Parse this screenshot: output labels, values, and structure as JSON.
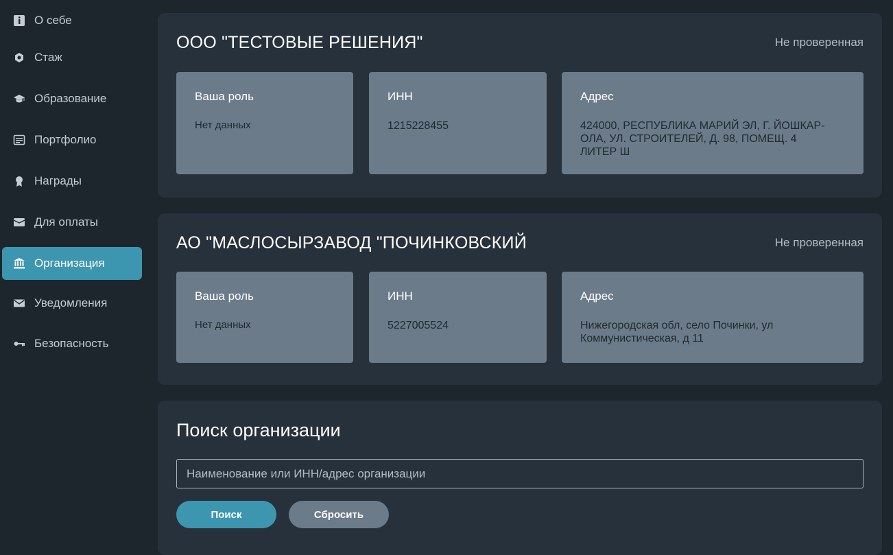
{
  "sidebar": {
    "items": [
      {
        "label": "О себе",
        "icon": "info-icon"
      },
      {
        "label": "Стаж",
        "icon": "hexagon-icon"
      },
      {
        "label": "Образование",
        "icon": "graduation-cap-icon"
      },
      {
        "label": "Портфолио",
        "icon": "document-list-icon"
      },
      {
        "label": "Награды",
        "icon": "award-icon"
      },
      {
        "label": "Для оплаты",
        "icon": "wallet-icon"
      },
      {
        "label": "Организация",
        "icon": "bank-icon",
        "active": true
      },
      {
        "label": "Уведомления",
        "icon": "envelope-icon"
      },
      {
        "label": "Безопасность",
        "icon": "key-icon"
      }
    ]
  },
  "organizations": [
    {
      "name": "ООО \"ТЕСТОВЫЕ РЕШЕНИЯ\"",
      "status": "Не проверенная",
      "role_title": "Ваша роль",
      "role_value": "Нет данных",
      "inn_title": "ИНН",
      "inn_value": "1215228455",
      "address_title": "Адрес",
      "address_value": "424000, РЕСПУБЛИКА МАРИЙ ЭЛ, Г. ЙОШКАР-ОЛА, УЛ. СТРОИТЕЛЕЙ, Д. 98, ПОМЕЩ. 4 ЛИТЕР Ш"
    },
    {
      "name": "АО \"МАСЛОСЫРЗАВОД \"ПОЧИНКОВСКИЙ",
      "status": "Не проверенная",
      "role_title": "Ваша роль",
      "role_value": "Нет данных",
      "inn_title": "ИНН",
      "inn_value": "5227005524",
      "address_title": "Адрес",
      "address_value": "Нижегородская обл, село Починки, ул Коммунистическая, д 11"
    }
  ],
  "search": {
    "title": "Поиск организации",
    "placeholder": "Наименование или ИНН/адрес организации",
    "value": "",
    "search_button": "Поиск",
    "reset_button": "Сбросить"
  },
  "colors": {
    "accent": "#3d96b0",
    "background": "#1d252d",
    "card": "#27313b",
    "info_box": "#6b7b89"
  }
}
